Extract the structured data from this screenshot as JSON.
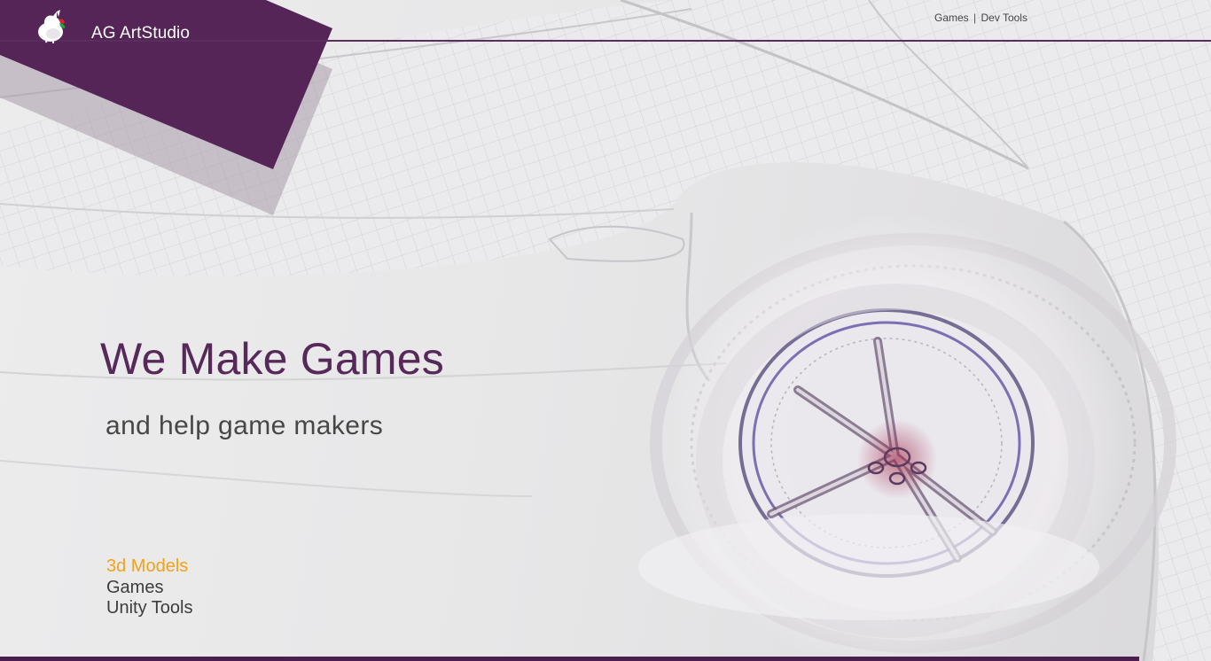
{
  "brand": {
    "name": "AG ArtStudio",
    "logo_icon": "unicorn-logo-icon"
  },
  "top_nav": {
    "items": [
      "Games",
      "Dev Tools"
    ],
    "separator": "|"
  },
  "hero": {
    "title": "We Make Games",
    "subtitle": "and help game makers"
  },
  "links": {
    "items": [
      {
        "label": "3d Models",
        "active": true
      },
      {
        "label": "Games",
        "active": false
      },
      {
        "label": "Unity Tools",
        "active": false
      }
    ]
  },
  "colors": {
    "brand_purple": "#57285a",
    "accent_orange": "#f0a21a",
    "text_dark": "#474747"
  }
}
